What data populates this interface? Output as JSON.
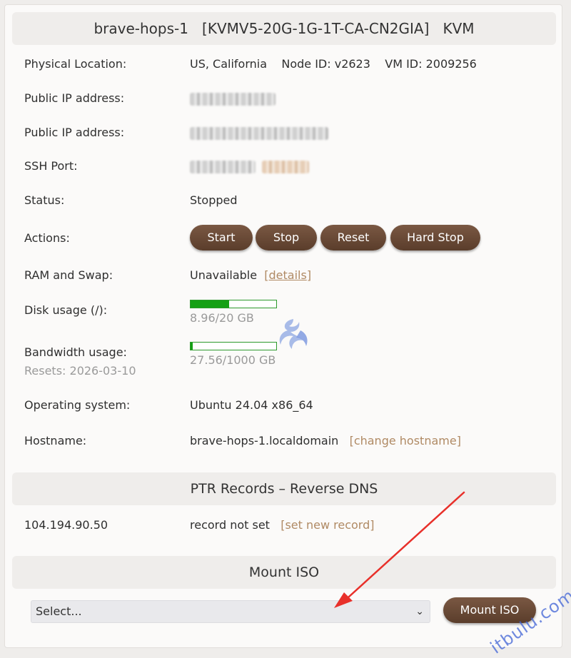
{
  "header": {
    "hostname": "brave-hops-1",
    "plan": "[KVMV5-20G-1G-1T-CA-CN2GIA]",
    "virt": "KVM"
  },
  "rows": {
    "location": {
      "label": "Physical Location:",
      "value": "US, California",
      "node": "Node ID: v2623",
      "vm": "VM ID: 2009256"
    },
    "ip4": {
      "label": "Public IP address:"
    },
    "ip6": {
      "label": "Public IP address:"
    },
    "ssh": {
      "label": "SSH Port:"
    },
    "status": {
      "label": "Status:",
      "value": "Stopped"
    },
    "actions": {
      "label": "Actions:"
    },
    "ram": {
      "label": "RAM and Swap:",
      "value": "Unavailable",
      "details_link": "details"
    },
    "disk": {
      "label": "Disk usage (/):",
      "value": "8.96/20 GB",
      "used_fraction": 0.448
    },
    "bandwidth": {
      "label": "Bandwidth usage:",
      "resets": "Resets: 2026-03-10",
      "value": "27.56/1000 GB",
      "used_fraction": 0.0276
    },
    "os": {
      "label": "Operating system:",
      "value": "Ubuntu 24.04 x86_64"
    },
    "hostname": {
      "label": "Hostname:",
      "value": "brave-hops-1.localdomain",
      "change_link": "change hostname"
    }
  },
  "actions": {
    "start": "Start",
    "stop": "Stop",
    "reset": "Reset",
    "hard_stop": "Hard Stop"
  },
  "ptr": {
    "title": "PTR Records – Reverse DNS",
    "ip": "104.194.90.50",
    "status": "record not set",
    "set_link": "set new record"
  },
  "iso": {
    "title": "Mount ISO",
    "select_value": "Select...",
    "button": "Mount ISO"
  },
  "watermark": {
    "text": "itbulu.com"
  },
  "colors": {
    "button": "#6a4a36",
    "link": "#b08a64",
    "bar_fill": "#14a014",
    "arrow": "#e8302a"
  }
}
